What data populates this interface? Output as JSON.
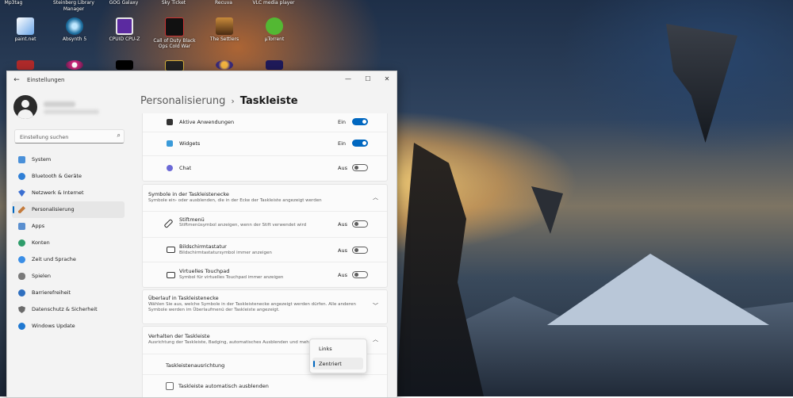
{
  "desktop": {
    "top_labels": [
      "Mp3tag",
      "Steinberg Library Manager",
      "GOG Galaxy",
      "Sky Ticket",
      "Recuva",
      "VLC media player"
    ],
    "icons": [
      {
        "label": "paint.net",
        "icon": "paintnet-icon"
      },
      {
        "label": "Absynth 5",
        "icon": "absynth-icon"
      },
      {
        "label": "CPUID CPU-Z",
        "icon": "cpuz-icon"
      },
      {
        "label": "Call of Duty Black Ops Cold War",
        "icon": "black-ops-icon"
      },
      {
        "label": "The Settlers",
        "icon": "settlers-icon"
      },
      {
        "label": "µTorrent",
        "icon": "utorrent-icon"
      }
    ]
  },
  "window": {
    "title": "Einstellungen",
    "controls": {
      "minimize": "—",
      "maximize": "☐",
      "close": "✕"
    }
  },
  "search": {
    "placeholder": "Einstellung suchen"
  },
  "sidebar": {
    "items": [
      {
        "label": "System",
        "color": "#4a90d9"
      },
      {
        "label": "Bluetooth & Geräte",
        "color": "#2f7fd6"
      },
      {
        "label": "Netzwerk & Internet",
        "color": "#3b6fd1"
      },
      {
        "label": "Personalisierung",
        "color": "#c47b3c",
        "active": true
      },
      {
        "label": "Apps",
        "color": "#5a8fcf"
      },
      {
        "label": "Konten",
        "color": "#2e9c6a"
      },
      {
        "label": "Zeit und Sprache",
        "color": "#3a8ee6"
      },
      {
        "label": "Spielen",
        "color": "#7a7a7a"
      },
      {
        "label": "Barrierefreiheit",
        "color": "#2f6fbf"
      },
      {
        "label": "Datenschutz & Sicherheit",
        "color": "#6b6b6b"
      },
      {
        "label": "Windows Update",
        "color": "#1f78d1"
      }
    ]
  },
  "breadcrumb": {
    "parent": "Personalisierung",
    "separator": "›",
    "current": "Taskleiste"
  },
  "taskbar_items": [
    {
      "label": "Aktive Anwendungen",
      "state": "Ein",
      "on": true
    },
    {
      "label": "Widgets",
      "state": "Ein",
      "on": true
    },
    {
      "label": "Chat",
      "state": "Aus",
      "on": false
    }
  ],
  "corner_icons": {
    "title": "Symbole in der Taskleistenecke",
    "subtitle": "Symbole ein- oder ausblenden, die in der Ecke der Taskleiste angezeigt werden",
    "items": [
      {
        "label": "Stiftmenü",
        "subtitle": "Stiftmenüsymbol anzeigen, wenn der Stift verwendet wird",
        "state": "Aus",
        "on": false
      },
      {
        "label": "Bildschirmtastatur",
        "subtitle": "Bildschirmtastatursymbol immer anzeigen",
        "state": "Aus",
        "on": false
      },
      {
        "label": "Virtuelles Touchpad",
        "subtitle": "Symbol für virtuelles Touchpad immer anzeigen",
        "state": "Aus",
        "on": false
      }
    ]
  },
  "overflow": {
    "title": "Überlauf in Taskleistenecke",
    "subtitle": "Wählen Sie aus, welche Symbole in der Taskleistenecke angezeigt werden dürfen. Alle anderen Symbole werden im Überlaufmenü der Taskleiste angezeigt."
  },
  "behavior": {
    "title": "Verhalten der Taskleiste",
    "subtitle": "Ausrichtung der Taskleiste, Badging, automatisches Ausblenden und mehrere",
    "alignment_label": "Taskleistenausrichtung",
    "alignment_options": [
      "Links",
      "Zentriert"
    ],
    "alignment_selected": "Zentriert",
    "autohide_label": "Taskleiste automatisch ausblenden"
  }
}
